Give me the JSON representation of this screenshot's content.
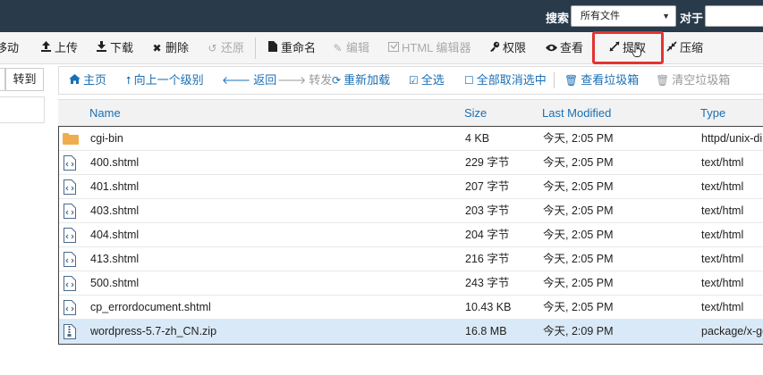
{
  "header": {
    "search_label": "搜索",
    "search_scope": "所有文件",
    "for_label": "对于",
    "search_value": ""
  },
  "toolbar": {
    "items": [
      {
        "label": "移动",
        "icon": "move-icon"
      },
      {
        "label": "上传",
        "icon": "upload-icon"
      },
      {
        "label": "下载",
        "icon": "download-icon"
      },
      {
        "label": "删除",
        "icon": "delete-icon"
      },
      {
        "label": "还原",
        "icon": "restore-icon"
      },
      {
        "label": "重命名",
        "icon": "rename-icon"
      },
      {
        "label": "编辑",
        "icon": "edit-icon"
      },
      {
        "label": "HTML 编辑器",
        "icon": "html-editor-icon"
      },
      {
        "label": "权限",
        "icon": "key-icon"
      },
      {
        "label": "查看",
        "icon": "eye-icon"
      },
      {
        "label": "提取",
        "icon": "expand-icon"
      },
      {
        "label": "压缩",
        "icon": "compress-icon"
      }
    ],
    "highlight_color": "#e3342f"
  },
  "left_panel": {
    "go_button": "转到"
  },
  "nav": {
    "home": "主页",
    "up_one_level": "向上一个级别",
    "back": "返回",
    "forward": "转发",
    "reload": "重新加载",
    "select_all": "全选",
    "unselect_all": "全部取消选中",
    "view_trash": "查看垃圾箱",
    "empty_trash": "清空垃圾箱"
  },
  "table": {
    "columns": [
      "Name",
      "Size",
      "Last Modified",
      "Type"
    ],
    "rows": [
      {
        "name": "cgi-bin",
        "size": "4 KB",
        "modified": "今天, 2:05 PM",
        "type": "httpd/unix-directory",
        "icon": "folder-icon"
      },
      {
        "name": "400.shtml",
        "size": "229 字节",
        "modified": "今天, 2:05 PM",
        "type": "text/html",
        "icon": "html-file-icon"
      },
      {
        "name": "401.shtml",
        "size": "207 字节",
        "modified": "今天, 2:05 PM",
        "type": "text/html",
        "icon": "html-file-icon"
      },
      {
        "name": "403.shtml",
        "size": "203 字节",
        "modified": "今天, 2:05 PM",
        "type": "text/html",
        "icon": "html-file-icon"
      },
      {
        "name": "404.shtml",
        "size": "204 字节",
        "modified": "今天, 2:05 PM",
        "type": "text/html",
        "icon": "html-file-icon"
      },
      {
        "name": "413.shtml",
        "size": "216 字节",
        "modified": "今天, 2:05 PM",
        "type": "text/html",
        "icon": "html-file-icon"
      },
      {
        "name": "500.shtml",
        "size": "243 字节",
        "modified": "今天, 2:05 PM",
        "type": "text/html",
        "icon": "html-file-icon"
      },
      {
        "name": "cp_errordocument.shtml",
        "size": "10.43 KB",
        "modified": "今天, 2:05 PM",
        "type": "text/html",
        "icon": "html-file-icon"
      },
      {
        "name": "wordpress-5.7-zh_CN.zip",
        "size": "16.8 MB",
        "modified": "今天, 2:09 PM",
        "type": "package/x-generic",
        "icon": "zip-file-icon"
      }
    ]
  }
}
